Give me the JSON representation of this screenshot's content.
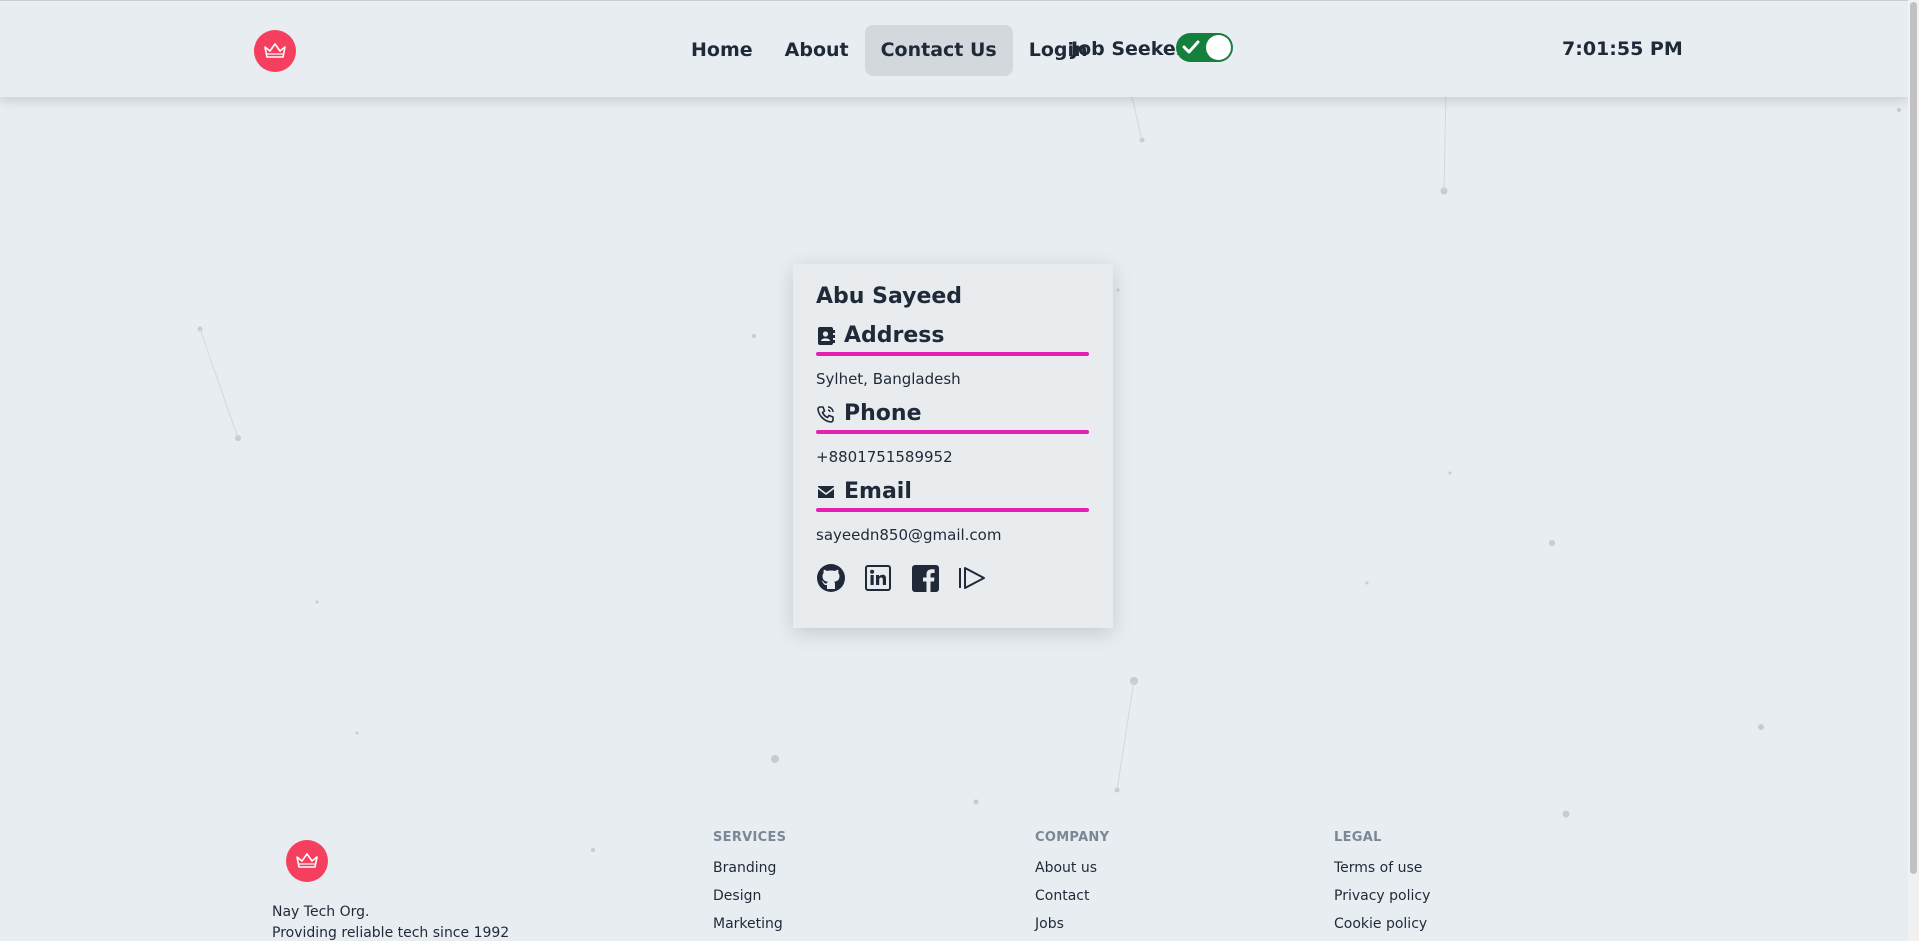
{
  "nav": {
    "items": [
      {
        "label": "Home",
        "active": false
      },
      {
        "label": "About",
        "active": false
      },
      {
        "label": "Contact Us",
        "active": true
      },
      {
        "label": "Login",
        "active": false
      }
    ],
    "job_seeker_label": "Job Seeker",
    "job_seeker_on": true,
    "clock": "7:01:55 PM"
  },
  "card": {
    "name": "Abu Sayeed",
    "address_title": "Address",
    "address_value": "Sylhet, Bangladesh",
    "phone_title": "Phone",
    "phone_value": "+8801751589952",
    "email_title": "Email",
    "email_value": "sayeedn850@gmail.com",
    "socials": [
      "github-icon",
      "linkedin-icon",
      "facebook-icon",
      "play-icon"
    ]
  },
  "footer": {
    "org_name": "Nay Tech Org.",
    "tagline": "Providing reliable tech since 1992",
    "services": {
      "heading": "SERVICES",
      "links": [
        "Branding",
        "Design",
        "Marketing"
      ]
    },
    "company": {
      "heading": "COMPANY",
      "links": [
        "About us",
        "Contact",
        "Jobs"
      ]
    },
    "legal": {
      "heading": "LEGAL",
      "links": [
        "Terms of use",
        "Privacy policy",
        "Cookie policy"
      ]
    }
  },
  "colors": {
    "accent": "#e51fb4",
    "logo": "#f43f5e",
    "toggle_on": "#15803d",
    "background": "#e8edf1"
  }
}
